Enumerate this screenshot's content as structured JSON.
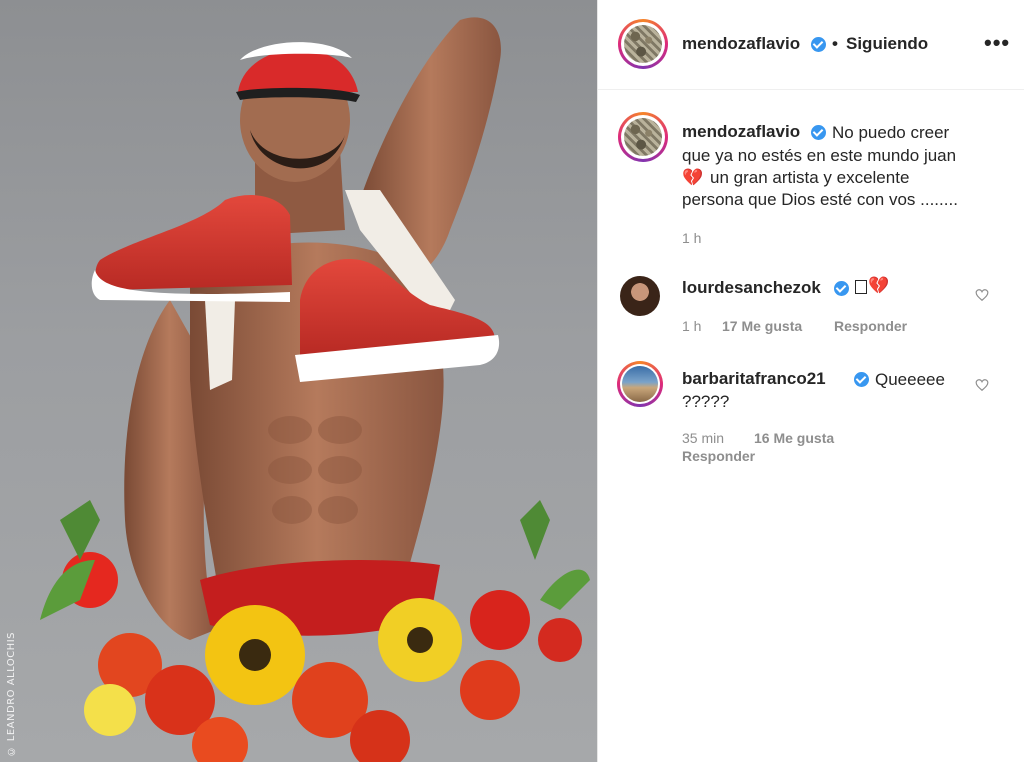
{
  "post": {
    "author": "mendozaflavio",
    "follow_status": "Siguiendo",
    "more_icon": "ellipsis-icon",
    "photo_credit": "© LEANDRO ALLOCHIS"
  },
  "caption": {
    "username": "mendozaflavio",
    "line1": "No puedo creer",
    "line2": "que ya no estés en este mundo juan",
    "line3": "un gran artista y excelente",
    "line4": "persona que Dios esté con vos ........",
    "time": "1 h"
  },
  "comments": [
    {
      "username": "lourdesanchezok",
      "text": "",
      "time": "1 h",
      "likes": "17 Me gusta",
      "reply": "Responder"
    },
    {
      "username": "barbaritafranco21",
      "text_line1": "Queeeee",
      "text_line2": "?????",
      "time": "35 min",
      "likes": "16 Me gusta",
      "reply": "Responder"
    }
  ],
  "colors": {
    "verified": "#3897f0",
    "text": "#262626",
    "meta": "#8e8e8e"
  }
}
